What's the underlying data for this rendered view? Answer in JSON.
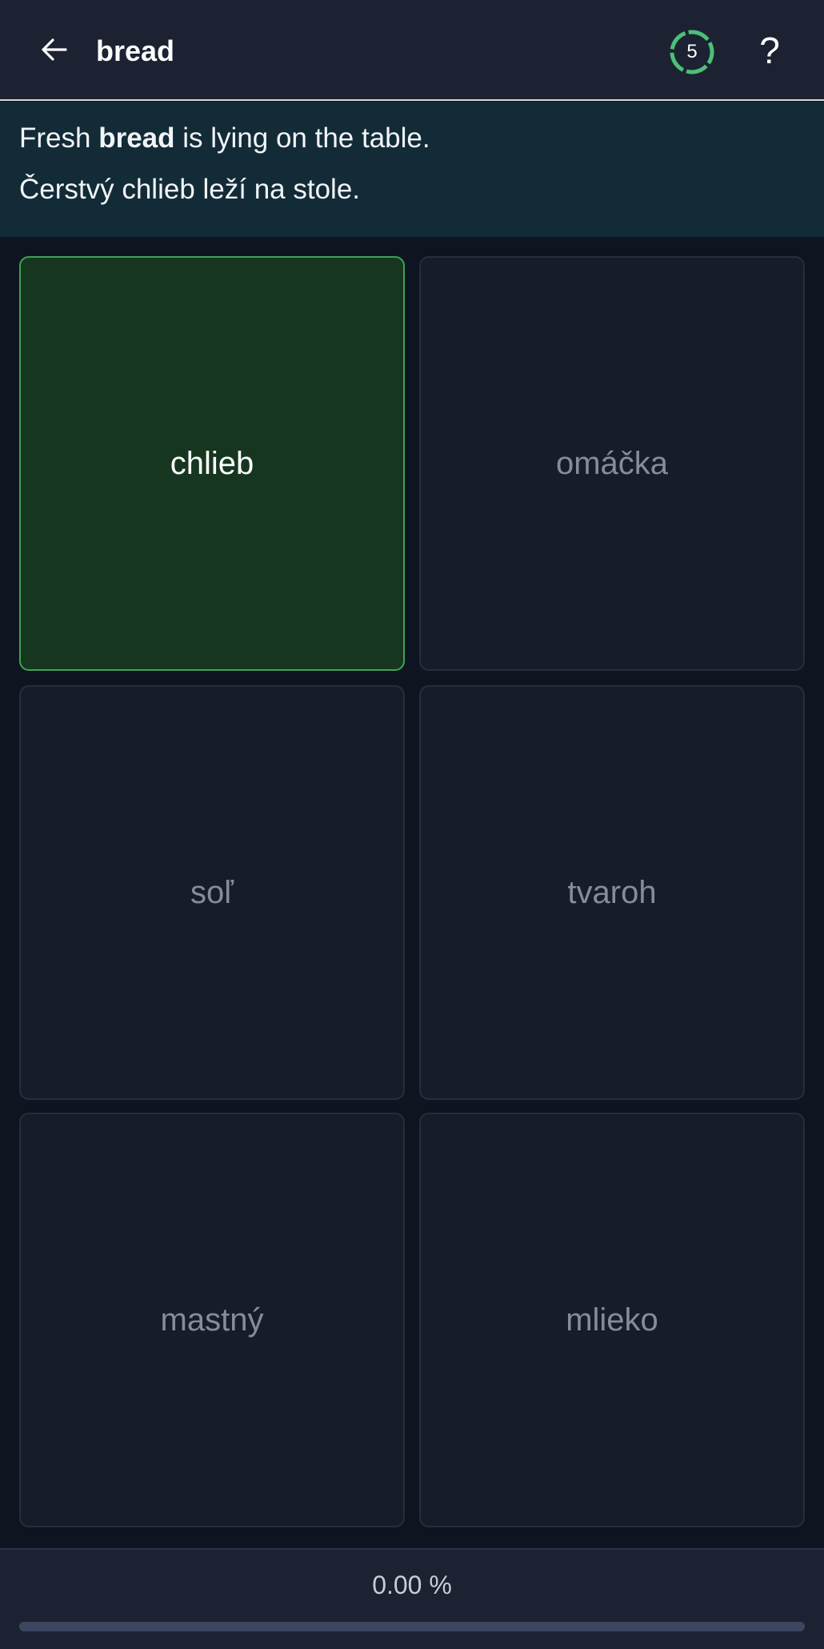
{
  "header": {
    "title": "bread",
    "counter": "5",
    "help_label": "?"
  },
  "sentence": {
    "english_before": "Fresh ",
    "english_keyword": "bread",
    "english_after": " is lying on the table.",
    "slovak": "Čerstvý chlieb leží na stole."
  },
  "options": [
    {
      "label": "chlieb",
      "selected": true
    },
    {
      "label": "omáčka",
      "selected": false
    },
    {
      "label": "soľ",
      "selected": false
    },
    {
      "label": "tvaroh",
      "selected": false
    },
    {
      "label": "mastný",
      "selected": false
    },
    {
      "label": "mlieko",
      "selected": false
    }
  ],
  "progress": {
    "text": "0.00 %",
    "value": 0
  },
  "colors": {
    "selected_card": "#17361f",
    "selected_border": "#3ca356",
    "counter_ring": "#4cc077",
    "sentence_panel": "#122b37"
  },
  "icons": {
    "back": "arrow-left-icon",
    "counter": "dashed-ring-icon"
  }
}
